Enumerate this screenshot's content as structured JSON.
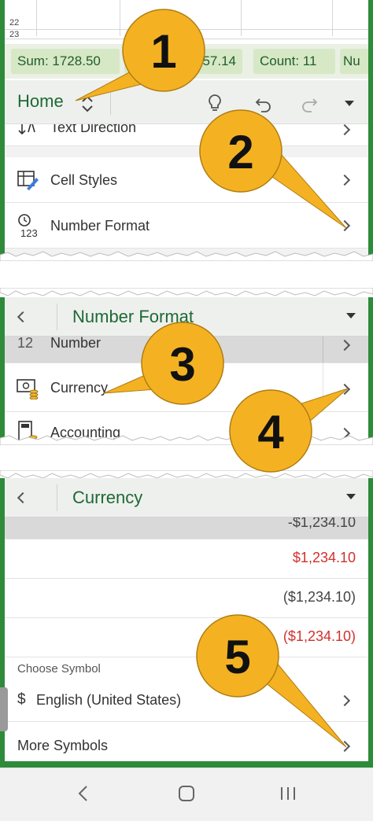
{
  "panel1": {
    "grid_rows": [
      "22",
      "23"
    ],
    "status_chips": [
      {
        "label": "Sum: 1728.50"
      },
      {
        "label": "57.14"
      },
      {
        "label": "Count: 11"
      },
      {
        "label": "Nu"
      }
    ],
    "toolbar": {
      "tab_label": "Home",
      "icons": [
        "lightbulb-icon",
        "undo-icon",
        "redo-icon",
        "dropdown-caret-icon"
      ]
    },
    "menu_items": [
      {
        "label": "Text Direction",
        "icon": "text-direction-icon"
      },
      {
        "label": "Cell Styles",
        "icon": "cell-styles-icon"
      },
      {
        "label": "Number Format",
        "icon": "number-format-icon",
        "icon_text": "123"
      }
    ]
  },
  "panel2": {
    "header_title": "Number Format",
    "menu_items": [
      {
        "label": "Number",
        "icon_text": "12"
      },
      {
        "label": "Currency",
        "icon": "currency-icon"
      },
      {
        "label": "Accounting",
        "icon": "accounting-icon"
      }
    ]
  },
  "panel3": {
    "header_title": "Currency",
    "formats": [
      {
        "value": "-$1,234.10",
        "color": "#444444"
      },
      {
        "value": "$1,234.10",
        "color": "#d0312d"
      },
      {
        "value": "($1,234.10)",
        "color": "#444444"
      },
      {
        "value": "($1,234.10)",
        "color": "#d0312d"
      }
    ],
    "section_label": "Choose Symbol",
    "symbol_row": {
      "symbol": "$",
      "label": "English (United States)"
    },
    "more_symbols_label": "More Symbols"
  },
  "callouts": [
    "1",
    "2",
    "3",
    "4",
    "5"
  ],
  "colors": {
    "accent_green": "#2e8b3a",
    "callout_fill": "#f4b223",
    "negative_red": "#d0312d"
  }
}
